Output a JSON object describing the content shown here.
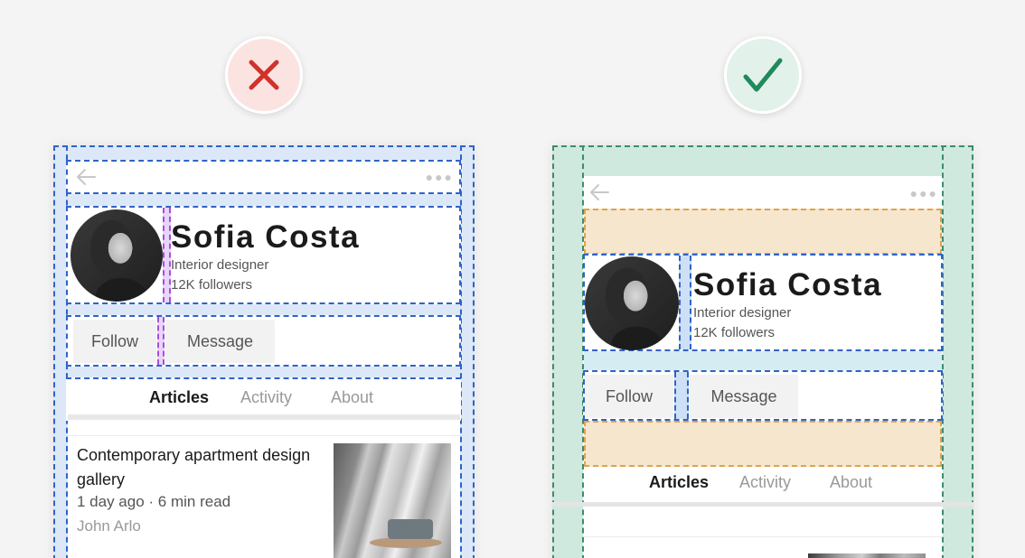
{
  "colors": {
    "bad_badge_bg": "#fbe3e1",
    "bad_mark": "#d0322a",
    "good_badge_bg": "#e2f1ea",
    "good_mark": "#1f8a5b",
    "guide_blue": "#2f63c6",
    "guide_green": "#3d8c6b",
    "guide_orange": "#e2a24a",
    "guide_purple": "#a64de0"
  },
  "badges": {
    "bad": {
      "icon": "x-mark-icon"
    },
    "good": {
      "icon": "check-mark-icon"
    }
  },
  "profile": {
    "name": "Sofia Costa",
    "role": "Interior designer",
    "followers": "12K followers"
  },
  "actions": {
    "follow": "Follow",
    "message": "Message"
  },
  "tabs": [
    "Articles",
    "Activity",
    "About"
  ],
  "article": {
    "title": "Contemporary apartment design gallery",
    "meta": "1 day ago · 6 min read",
    "author": "John Arlo"
  },
  "icons": {
    "back": "arrow-left-icon",
    "more": "more-dots-icon"
  }
}
